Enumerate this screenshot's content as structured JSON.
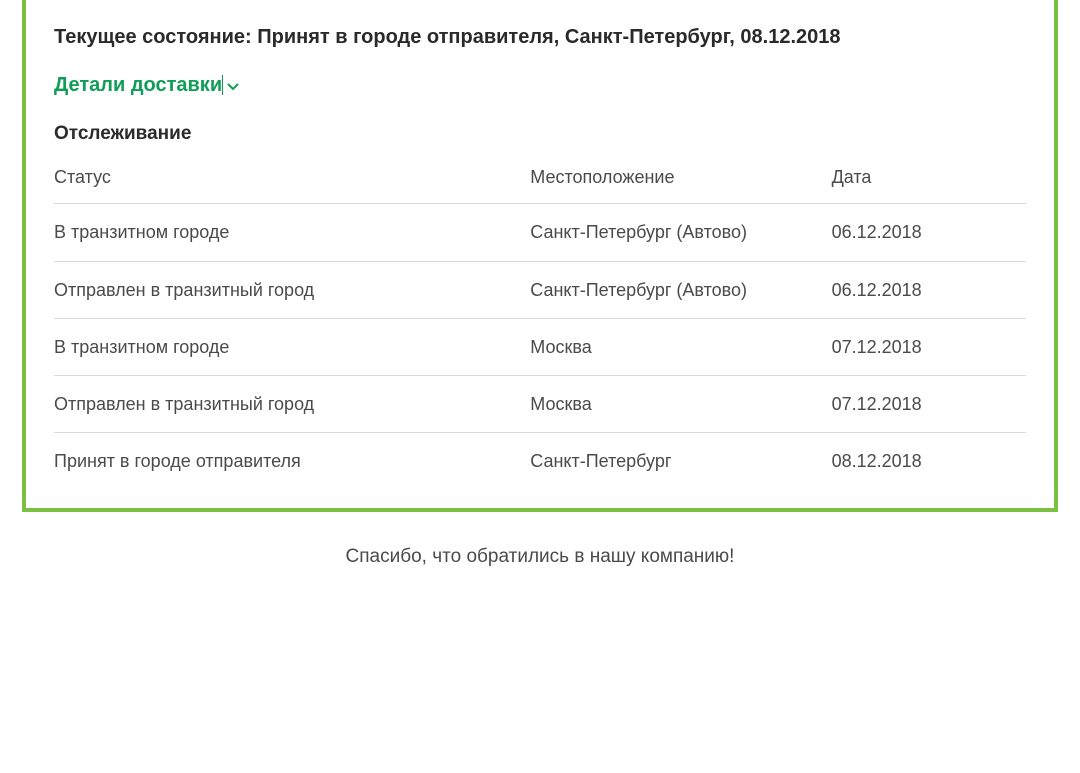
{
  "current_status_label": "Текущее состояние: ",
  "current_status_value": "Принят в городе отправителя, Санкт-Петербург, 08.12.2018",
  "details_toggle": "Детали доставки",
  "tracking_heading": "Отслеживание",
  "columns": {
    "status": "Статус",
    "location": "Местоположение",
    "date": "Дата"
  },
  "rows": [
    {
      "status": "В транзитном городе",
      "location": "Санкт-Петербург (Автово)",
      "date": "06.12.2018"
    },
    {
      "status": "Отправлен в транзитный город",
      "location": "Санкт-Петербург (Автово)",
      "date": "06.12.2018"
    },
    {
      "status": "В транзитном городе",
      "location": "Москва",
      "date": "07.12.2018"
    },
    {
      "status": "Отправлен в транзитный город",
      "location": "Москва",
      "date": "07.12.2018"
    },
    {
      "status": "Принят в городе отправителя",
      "location": "Санкт-Петербург",
      "date": "08.12.2018"
    }
  ],
  "thanks": "Спасибо, что обратились в нашу компанию!"
}
